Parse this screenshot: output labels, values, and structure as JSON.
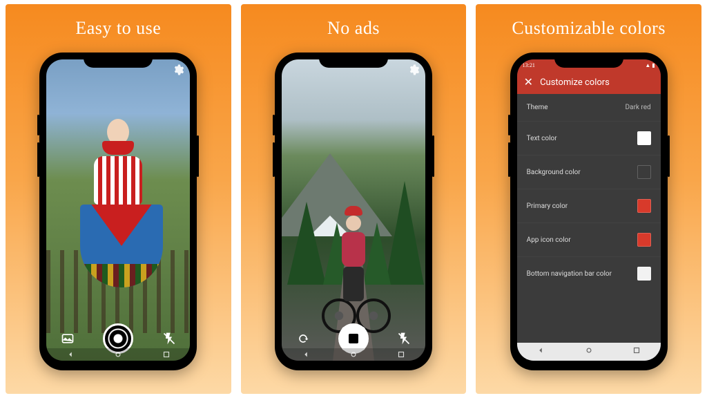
{
  "panels": [
    {
      "headline": "Easy to use"
    },
    {
      "headline": "No ads"
    },
    {
      "headline": "Customizable colors"
    }
  ],
  "camera": {
    "settings_icon": "gear",
    "gallery_icon": "last-photo",
    "flash_icon": "flash-off",
    "switch_icon": "switch-camera"
  },
  "settings": {
    "status_time": "13:21",
    "title": "Customize colors",
    "rows": [
      {
        "label": "Theme",
        "value": "Dark red",
        "swatch": null
      },
      {
        "label": "Text color",
        "value": "",
        "swatch": "#ffffff"
      },
      {
        "label": "Background color",
        "value": "",
        "swatch": "#3b3b3b"
      },
      {
        "label": "Primary color",
        "value": "",
        "swatch": "#d83a2b"
      },
      {
        "label": "App icon color",
        "value": "",
        "swatch": "#d83a2b"
      },
      {
        "label": "Bottom navigation bar color",
        "value": "",
        "swatch": "#f2f2f2"
      }
    ]
  }
}
